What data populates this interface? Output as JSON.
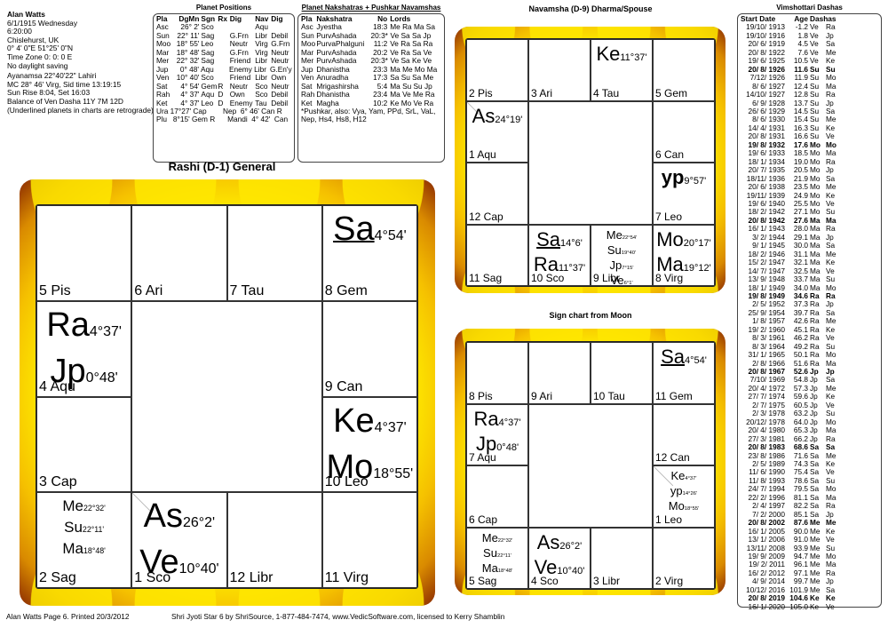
{
  "birth_info": {
    "name": "Alan Watts",
    "lines": [
      "6/1/1915  Wednesday",
      "6:20:00",
      "Chislehurst, UK",
      "0° 4' 0\"E 51°25' 0\"N",
      "Time Zone  0: 0: 0 E",
      "No daylight saving"
    ],
    "lines2": [
      "Ayanamsa 22°40'22\" Lahiri",
      "MC 28° 46' Virg,  Sid time 13:19:15",
      "Sun Rise 8:04, Set 16:03",
      "Balance of Ven Dasha 11Y 7M 12D",
      "(Underlined planets in charts are retrograde)"
    ]
  },
  "planet_positions": {
    "title": "Planet Positions",
    "headers": [
      "Pla",
      "DgMn",
      "Sgn",
      "Rx",
      "Dig",
      "Nav",
      "Dig"
    ],
    "rows": [
      [
        "Asc",
        "26°  2'",
        "Sco",
        "",
        "",
        "Aqu",
        ""
      ],
      [
        "Sun",
        "22° 11'",
        "Sag",
        "",
        "G.Frn",
        "Libr",
        "Debil"
      ],
      [
        "Moo",
        "18° 55'",
        "Leo",
        "",
        "Neutr",
        "Virg",
        "G.Frn"
      ],
      [
        "Mar",
        "18° 48'",
        "Sag",
        "",
        "G.Frn",
        "Virg",
        "Neutr"
      ],
      [
        "Mer",
        "22° 32'",
        "Sag",
        "",
        "Friend",
        "Libr",
        "Neutr"
      ],
      [
        "Jup",
        "0° 48'",
        "Aqu",
        "",
        "Enemy",
        "Libr",
        "G.En'y"
      ],
      [
        "Ven",
        "10° 40'",
        "Sco",
        "",
        "Friend",
        "Libr",
        "Own"
      ],
      [
        "Sat",
        "4° 54'",
        "Gem",
        "R",
        "Neutr",
        "Sco",
        "Neutr"
      ],
      [
        "Rah",
        "4° 37'",
        "Aqu",
        "D",
        "Own",
        "Sco",
        "Debil"
      ],
      [
        "Ket",
        "4° 37'",
        "Leo",
        "D",
        "Enemy",
        "Tau",
        "Debil"
      ]
    ],
    "extra": [
      "Ura 17°27' Cap        Nep  6° 46' Can R",
      "Plu   8°15' Gem R      Mandi  4° 42'  Can"
    ]
  },
  "nakshatras": {
    "title": "Planet Nakshatras + Pushkar Navamshas",
    "headers": [
      "Pla",
      "Nakshatra",
      "No",
      "Lords"
    ],
    "rows": [
      [
        "Asc",
        "Jyestha",
        "18:3",
        "Me Ra Ma Sa"
      ],
      [
        "Sun",
        "PurvAshada",
        "20:3*",
        "Ve Sa Sa Jp"
      ],
      [
        "Moo",
        "PurvaPhalguni",
        "11:2",
        "Ve Ra Sa Ra"
      ],
      [
        "Mar",
        "PurvAshada",
        "20:2",
        "Ve Ra Sa Ve"
      ],
      [
        "Mer",
        "PurvAshada",
        "20:3*",
        "Ve Sa Ke Ve"
      ],
      [
        "Jup",
        "Dhanistha",
        "23:3",
        "Ma Me Mo Ma"
      ],
      [
        "Ven",
        "Anuradha",
        "17:3",
        "Sa Su Sa Me"
      ],
      [
        "Sat",
        "Mrigashirsha",
        "5:4",
        "Ma Su Su Jp"
      ],
      [
        "Rah",
        "Dhanistha",
        "23:4",
        "Ma Ve Me Ra"
      ],
      [
        "Ket",
        "Magha",
        "10:2",
        "Ke Mo Ve Ra"
      ]
    ],
    "note": [
      "*Pushkar, also: Vya, Yam, PPd, SrL, VaL,",
      "Nep, Hs4, Hs8, H12"
    ]
  },
  "dashas": {
    "title": "Vimshottari  Dashas",
    "headers": [
      "Start Date",
      "Age",
      "Dashas",
      ""
    ],
    "rows": [
      [
        "19/10/ 1913",
        "-1.2",
        "Ve",
        "Ra",
        false
      ],
      [
        "19/10/ 1916",
        "1.8",
        "Ve",
        "Jp",
        false
      ],
      [
        "20/ 6/ 1919",
        "4.5",
        "Ve",
        "Sa",
        false
      ],
      [
        "20/ 8/ 1922",
        "7.6",
        "Ve",
        "Me",
        false
      ],
      [
        "19/ 6/ 1925",
        "10.5",
        "Ve",
        "Ke",
        false
      ],
      [
        "20/ 8/ 1926",
        "11.6",
        "Su",
        "Su",
        true
      ],
      [
        "7/12/ 1926",
        "11.9",
        "Su",
        "Mo",
        false
      ],
      [
        "8/ 6/ 1927",
        "12.4",
        "Su",
        "Ma",
        false
      ],
      [
        "14/10/ 1927",
        "12.8",
        "Su",
        "Ra",
        false
      ],
      [
        "6/ 9/ 1928",
        "13.7",
        "Su",
        "Jp",
        false
      ],
      [
        "26/ 6/ 1929",
        "14.5",
        "Su",
        "Sa",
        false
      ],
      [
        "8/ 6/ 1930",
        "15.4",
        "Su",
        "Me",
        false
      ],
      [
        "14/ 4/ 1931",
        "16.3",
        "Su",
        "Ke",
        false
      ],
      [
        "20/ 8/ 1931",
        "16.6",
        "Su",
        "Ve",
        false
      ],
      [
        "19/ 8/ 1932",
        "17.6",
        "Mo",
        "Mo",
        true
      ],
      [
        "19/ 6/ 1933",
        "18.5",
        "Mo",
        "Ma",
        false
      ],
      [
        "18/ 1/ 1934",
        "19.0",
        "Mo",
        "Ra",
        false
      ],
      [
        "20/ 7/ 1935",
        "20.5",
        "Mo",
        "Jp",
        false
      ],
      [
        "18/11/ 1936",
        "21.9",
        "Mo",
        "Sa",
        false
      ],
      [
        "20/ 6/ 1938",
        "23.5",
        "Mo",
        "Me",
        false
      ],
      [
        "19/11/ 1939",
        "24.9",
        "Mo",
        "Ke",
        false
      ],
      [
        "19/ 6/ 1940",
        "25.5",
        "Mo",
        "Ve",
        false
      ],
      [
        "18/ 2/ 1942",
        "27.1",
        "Mo",
        "Su",
        false
      ],
      [
        "20/ 8/ 1942",
        "27.6",
        "Ma",
        "Ma",
        true
      ],
      [
        "16/ 1/ 1943",
        "28.0",
        "Ma",
        "Ra",
        false
      ],
      [
        "3/ 2/ 1944",
        "29.1",
        "Ma",
        "Jp",
        false
      ],
      [
        "9/ 1/ 1945",
        "30.0",
        "Ma",
        "Sa",
        false
      ],
      [
        "18/ 2/ 1946",
        "31.1",
        "Ma",
        "Me",
        false
      ],
      [
        "15/ 2/ 1947",
        "32.1",
        "Ma",
        "Ke",
        false
      ],
      [
        "14/ 7/ 1947",
        "32.5",
        "Ma",
        "Ve",
        false
      ],
      [
        "13/ 9/ 1948",
        "33.7",
        "Ma",
        "Su",
        false
      ],
      [
        "18/ 1/ 1949",
        "34.0",
        "Ma",
        "Mo",
        false
      ],
      [
        "19/ 8/ 1949",
        "34.6",
        "Ra",
        "Ra",
        true
      ],
      [
        "2/ 5/ 1952",
        "37.3",
        "Ra",
        "Jp",
        false
      ],
      [
        "25/ 9/ 1954",
        "39.7",
        "Ra",
        "Sa",
        false
      ],
      [
        "1/ 8/ 1957",
        "42.6",
        "Ra",
        "Me",
        false
      ],
      [
        "19/ 2/ 1960",
        "45.1",
        "Ra",
        "Ke",
        false
      ],
      [
        "8/ 3/ 1961",
        "46.2",
        "Ra",
        "Ve",
        false
      ],
      [
        "8/ 3/ 1964",
        "49.2",
        "Ra",
        "Su",
        false
      ],
      [
        "31/ 1/ 1965",
        "50.1",
        "Ra",
        "Mo",
        false
      ],
      [
        "2/ 8/ 1966",
        "51.6",
        "Ra",
        "Ma",
        false
      ],
      [
        "20/ 8/ 1967",
        "52.6",
        "Jp",
        "Jp",
        true
      ],
      [
        "7/10/ 1969",
        "54.8",
        "Jp",
        "Sa",
        false
      ],
      [
        "20/ 4/ 1972",
        "57.3",
        "Jp",
        "Me",
        false
      ],
      [
        "27/ 7/ 1974",
        "59.6",
        "Jp",
        "Ke",
        false
      ],
      [
        "2/ 7/ 1975",
        "60.5",
        "Jp",
        "Ve",
        false
      ],
      [
        "2/ 3/ 1978",
        "63.2",
        "Jp",
        "Su",
        false
      ],
      [
        "20/12/ 1978",
        "64.0",
        "Jp",
        "Mo",
        false
      ],
      [
        "20/ 4/ 1980",
        "65.3",
        "Jp",
        "Ma",
        false
      ],
      [
        "27/ 3/ 1981",
        "66.2",
        "Jp",
        "Ra",
        false
      ],
      [
        "20/ 8/ 1983",
        "68.6",
        "Sa",
        "Sa",
        true
      ],
      [
        "23/ 8/ 1986",
        "71.6",
        "Sa",
        "Me",
        false
      ],
      [
        "2/ 5/ 1989",
        "74.3",
        "Sa",
        "Ke",
        false
      ],
      [
        "11/ 6/ 1990",
        "75.4",
        "Sa",
        "Ve",
        false
      ],
      [
        "11/ 8/ 1993",
        "78.6",
        "Sa",
        "Su",
        false
      ],
      [
        "24/ 7/ 1994",
        "79.5",
        "Sa",
        "Mo",
        false
      ],
      [
        "22/ 2/ 1996",
        "81.1",
        "Sa",
        "Ma",
        false
      ],
      [
        "2/ 4/ 1997",
        "82.2",
        "Sa",
        "Ra",
        false
      ],
      [
        "7/ 2/ 2000",
        "85.1",
        "Sa",
        "Jp",
        false
      ],
      [
        "20/ 8/ 2002",
        "87.6",
        "Me",
        "Me",
        true
      ],
      [
        "16/ 1/ 2005",
        "90.0",
        "Me",
        "Ke",
        false
      ],
      [
        "13/ 1/ 2006",
        "91.0",
        "Me",
        "Ve",
        false
      ],
      [
        "13/11/ 2008",
        "93.9",
        "Me",
        "Su",
        false
      ],
      [
        "19/ 9/ 2009",
        "94.7",
        "Me",
        "Mo",
        false
      ],
      [
        "19/ 2/ 2011",
        "96.1",
        "Me",
        "Ma",
        false
      ],
      [
        "16/ 2/ 2012",
        "97.1",
        "Me",
        "Ra",
        false
      ],
      [
        "4/ 9/ 2014",
        "99.7",
        "Me",
        "Jp",
        false
      ],
      [
        "10/12/ 2016",
        "101.9",
        "Me",
        "Sa",
        false
      ],
      [
        "20/ 8/ 2019",
        "104.6",
        "Ke",
        "Ke",
        true
      ],
      [
        "16/ 1/ 2020",
        "105.0",
        "Ke",
        "Ve",
        false
      ]
    ]
  },
  "charts": {
    "rashi": {
      "title": "Rashi (D-1) General",
      "cells": [
        {
          "pos": "r0c0",
          "sign": "5 Pis",
          "planets": []
        },
        {
          "pos": "r0c1",
          "sign": "6 Ari",
          "planets": []
        },
        {
          "pos": "r0c2",
          "sign": "7 Tau",
          "planets": []
        },
        {
          "pos": "r0c3",
          "sign": "8 Gem",
          "planets": [
            {
              "abbr": "Sa",
              "deg": "4°54'",
              "retro": true
            }
          ]
        },
        {
          "pos": "r1c0",
          "sign": "4 Aqu",
          "planets": [
            {
              "abbr": "Ra",
              "deg": "4°37'"
            },
            {
              "abbr": "Jp",
              "deg": "0°48'"
            }
          ]
        },
        {
          "pos": "r1c3",
          "sign": "9 Can",
          "planets": []
        },
        {
          "pos": "r2c0",
          "sign": "3 Cap",
          "planets": []
        },
        {
          "pos": "r2c3",
          "sign": "10 Leo",
          "planets": [
            {
              "abbr": "Ke",
              "deg": "4°37'"
            },
            {
              "abbr": "Mo",
              "deg": "18°55'"
            }
          ]
        },
        {
          "pos": "r3c0",
          "sign": "2 Sag",
          "small": true,
          "planets": [
            {
              "abbr": "Me",
              "deg": "22°32'"
            },
            {
              "abbr": "Su",
              "deg": "22°11'"
            },
            {
              "abbr": "Ma",
              "deg": "18°48'"
            }
          ]
        },
        {
          "pos": "r3c1",
          "sign": "1 Sco",
          "asc": true,
          "planets": [
            {
              "abbr": "As",
              "deg": "26°2'"
            },
            {
              "abbr": "Ve",
              "deg": "10°40'"
            }
          ]
        },
        {
          "pos": "r3c2",
          "sign": "12 Libr",
          "planets": []
        },
        {
          "pos": "r3c3",
          "sign": "11 Virg",
          "planets": []
        }
      ]
    },
    "navamsha": {
      "title": "Navamsha (D-9) Dharma/Spouse",
      "cells": [
        {
          "pos": "r0c0",
          "sign": "2 Pis",
          "planets": []
        },
        {
          "pos": "r0c1",
          "sign": "3 Ari",
          "planets": []
        },
        {
          "pos": "r0c2",
          "sign": "4 Tau",
          "planets": [
            {
              "abbr": "Ke",
              "deg": "11°37'"
            }
          ]
        },
        {
          "pos": "r0c3",
          "sign": "5 Gem",
          "planets": []
        },
        {
          "pos": "r1c0",
          "sign": "1 Aqu",
          "asc": true,
          "planets": [
            {
              "abbr": "As",
              "deg": "24°19'"
            }
          ]
        },
        {
          "pos": "r1c3",
          "sign": "6 Can",
          "planets": []
        },
        {
          "pos": "r2c0",
          "sign": "12 Cap",
          "planets": []
        },
        {
          "pos": "r2c3",
          "sign": "7 Leo",
          "planets": [
            {
              "abbr": "yp",
              "deg": "9°57'",
              "bold": true
            }
          ]
        },
        {
          "pos": "r3c0",
          "sign": "11 Sag",
          "planets": []
        },
        {
          "pos": "r3c1",
          "sign": "10 Sco",
          "planets": [
            {
              "abbr": "Sa",
              "deg": "14°6'",
              "retro": true
            },
            {
              "abbr": "Ra",
              "deg": "11°37'"
            }
          ]
        },
        {
          "pos": "r3c2",
          "sign": "9 Libr",
          "small": true,
          "planets": [
            {
              "abbr": "Me",
              "deg": "22°54'"
            },
            {
              "abbr": "Su",
              "deg": "19°40'"
            },
            {
              "abbr": "Jp",
              "deg": "7°15'"
            },
            {
              "abbr": "Ve",
              "deg": "6°1'"
            }
          ]
        },
        {
          "pos": "r3c3",
          "sign": "8 Virg",
          "planets": [
            {
              "abbr": "Mo",
              "deg": "20°17'"
            },
            {
              "abbr": "Ma",
              "deg": "19°12'"
            }
          ]
        }
      ]
    },
    "moon": {
      "title": "Sign chart from Moon",
      "cells": [
        {
          "pos": "r0c0",
          "sign": "8 Pis",
          "planets": []
        },
        {
          "pos": "r0c1",
          "sign": "9 Ari",
          "planets": []
        },
        {
          "pos": "r0c2",
          "sign": "10 Tau",
          "planets": []
        },
        {
          "pos": "r0c3",
          "sign": "11 Gem",
          "planets": [
            {
              "abbr": "Sa",
              "deg": "4°54'",
              "retro": true
            }
          ]
        },
        {
          "pos": "r1c0",
          "sign": "7 Aqu",
          "planets": [
            {
              "abbr": "Ra",
              "deg": "4°37'"
            },
            {
              "abbr": "Jp",
              "deg": "0°48'"
            }
          ]
        },
        {
          "pos": "r1c3",
          "sign": "12 Can",
          "planets": []
        },
        {
          "pos": "r2c0",
          "sign": "6 Cap",
          "planets": []
        },
        {
          "pos": "r2c3",
          "sign": "1 Leo",
          "asc": true,
          "small": true,
          "planets": [
            {
              "abbr": "Ke",
              "deg": "4°37'"
            },
            {
              "abbr": "yp",
              "deg": "14°26'"
            },
            {
              "abbr": "Mo",
              "deg": "18°55'"
            }
          ]
        },
        {
          "pos": "r3c0",
          "sign": "5 Sag",
          "small": true,
          "planets": [
            {
              "abbr": "Me",
              "deg": "22°32'"
            },
            {
              "abbr": "Su",
              "deg": "22°11'"
            },
            {
              "abbr": "Ma",
              "deg": "18°48'"
            }
          ]
        },
        {
          "pos": "r3c1",
          "sign": "4 Sco",
          "planets": [
            {
              "abbr": "As",
              "deg": "26°2'"
            },
            {
              "abbr": "Ve",
              "deg": "10°40'"
            }
          ]
        },
        {
          "pos": "r3c2",
          "sign": "3 Libr",
          "planets": []
        },
        {
          "pos": "r3c3",
          "sign": "2 Virg",
          "planets": []
        }
      ]
    }
  },
  "footer": {
    "left": "Alan Watts  Page 6.   Printed 20/3/2012",
    "right": "Shri Jyoti Star 6 by ShriSource, 1-877-484-7474, www.VedicSoftware.com, licensed to Kerry Shamblin"
  },
  "colors": {
    "frame_yellow": "#ffe800",
    "frame_dark": "#8a2a00"
  }
}
